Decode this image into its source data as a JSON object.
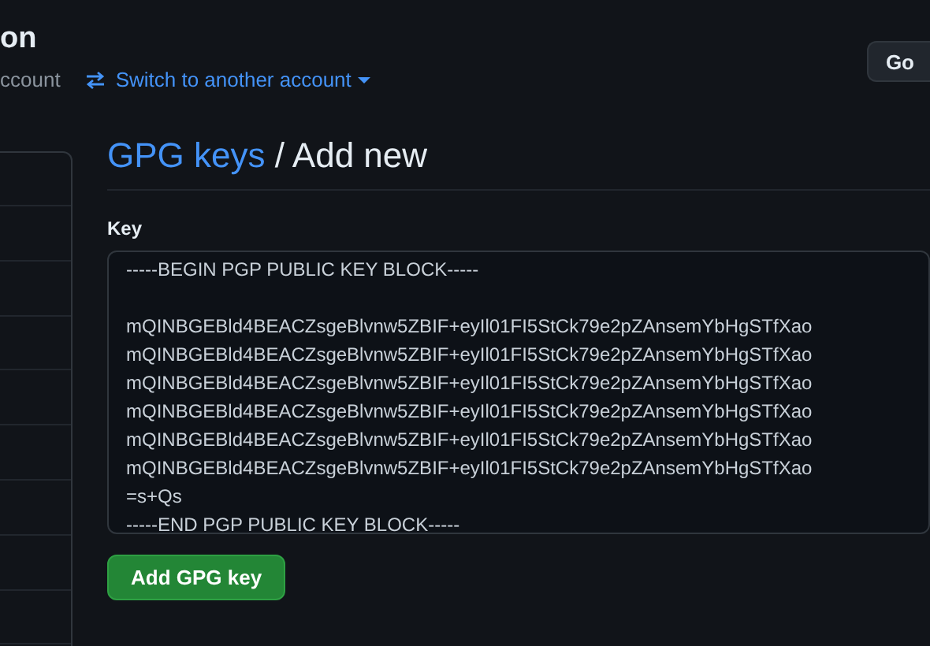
{
  "account": {
    "name": "on",
    "subtitle": "ccount",
    "switch_link": "Switch to another account",
    "go_button": "Go"
  },
  "heading": {
    "link": "GPG keys",
    "separator": "/",
    "title": "Add new"
  },
  "key_field": {
    "label": "Key",
    "value": "-----BEGIN PGP PUBLIC KEY BLOCK-----\n\nmQINBGEBld4BEACZsgeBlvnw5ZBIF+eyIl01FI5StCk79e2pZAnsemYbHgSTfXao\nmQINBGEBld4BEACZsgeBlvnw5ZBIF+eyIl01FI5StCk79e2pZAnsemYbHgSTfXao\nmQINBGEBld4BEACZsgeBlvnw5ZBIF+eyIl01FI5StCk79e2pZAnsemYbHgSTfXao\nmQINBGEBld4BEACZsgeBlvnw5ZBIF+eyIl01FI5StCk79e2pZAnsemYbHgSTfXao\nmQINBGEBld4BEACZsgeBlvnw5ZBIF+eyIl01FI5StCk79e2pZAnsemYbHgSTfXao\nmQINBGEBld4BEACZsgeBlvnw5ZBIF+eyIl01FI5StCk79e2pZAnsemYbHgSTfXao\n=s+Qs\n-----END PGP PUBLIC KEY BLOCK-----"
  },
  "submit_button": "Add GPG key"
}
